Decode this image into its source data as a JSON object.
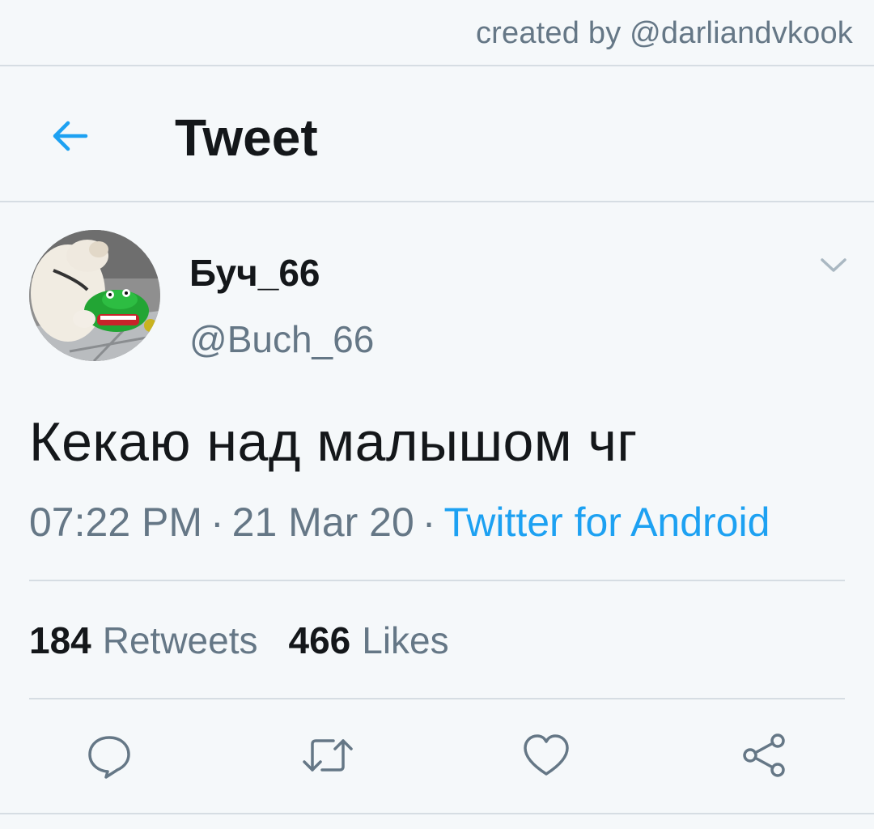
{
  "watermark": "created by @darliandvkook",
  "header": {
    "title": "Tweet"
  },
  "tweet": {
    "author": {
      "display_name": "Буч_66",
      "handle": "@Buch_66"
    },
    "text": "Кекаю над малышом чг",
    "time": "07:22 PM",
    "date": "21 Mar 20",
    "separator": "·",
    "source": "Twitter for Android",
    "stats": {
      "retweets_count": "184",
      "retweets_label": "Retweets",
      "likes_count": "466",
      "likes_label": "Likes"
    }
  },
  "colors": {
    "background": "#f5f8fa",
    "accent": "#1da1f2",
    "text_primary": "#14171a",
    "text_secondary": "#657786",
    "divider": "#d6dde3"
  },
  "icons": {
    "back": "arrow-left-icon",
    "caret": "chevron-down-icon",
    "reply": "reply-icon",
    "retweet": "retweet-icon",
    "like": "heart-icon",
    "share": "share-icon"
  }
}
